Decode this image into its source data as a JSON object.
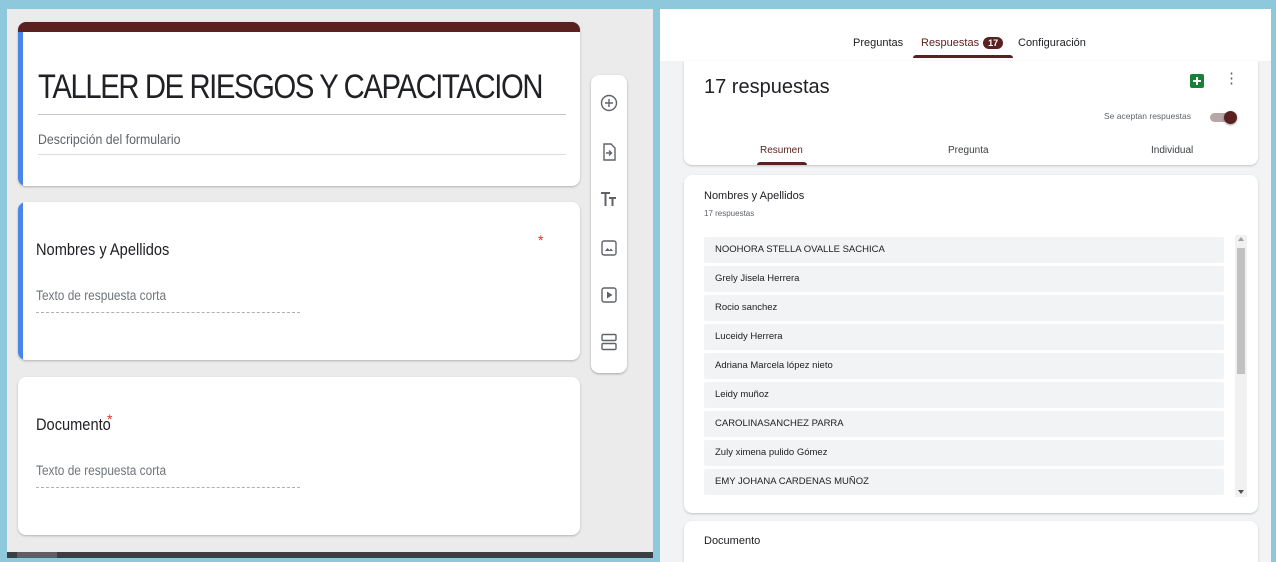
{
  "editor": {
    "form_title": "TALLER  DE RIESGOS Y CAPACITACION",
    "form_description": "Descripción del formulario",
    "questions": [
      {
        "title": "Nombres  y Apellidos",
        "required_mark": "*",
        "answer_placeholder": "Texto de respuesta corta"
      },
      {
        "title": "Documento",
        "required_mark": "*",
        "answer_placeholder": "Texto de respuesta corta"
      }
    ],
    "toolbar_icons": [
      "add-question-icon",
      "import-questions-icon",
      "add-title-icon",
      "add-image-icon",
      "add-video-icon",
      "add-section-icon"
    ]
  },
  "responses": {
    "tabs": [
      {
        "label": "Preguntas"
      },
      {
        "label": "Respuestas",
        "badge": "17"
      },
      {
        "label": "Configuración"
      }
    ],
    "active_tab": "Respuestas",
    "count_label": "17 respuestas",
    "accepting_label": "Se aceptan respuestas",
    "accepting_on": true,
    "sub_tabs": [
      "Resumen",
      "Pregunta",
      "Individual"
    ],
    "active_sub_tab": "Resumen",
    "names_question": {
      "title": "Nombres y Apellidos",
      "count": "17 respuestas",
      "answers": [
        "NOOHORA STELLA OVALLE SACHICA",
        "Grely Jisela Herrera",
        "Rocio sanchez",
        "Luceidy Herrera",
        "Adriana Marcela lópez nieto",
        "Leidy muñoz",
        "CAROLINASANCHEZ PARRA",
        "Zuly ximena pulido Gómez",
        "EMY JOHANA CARDENAS MUÑOZ"
      ]
    },
    "document_question": {
      "title": "Documento"
    }
  },
  "colors": {
    "theme": "#5b2120",
    "accent_blue": "#4a86e8",
    "sheets_green": "#188038",
    "background": "#8ec8dc"
  }
}
